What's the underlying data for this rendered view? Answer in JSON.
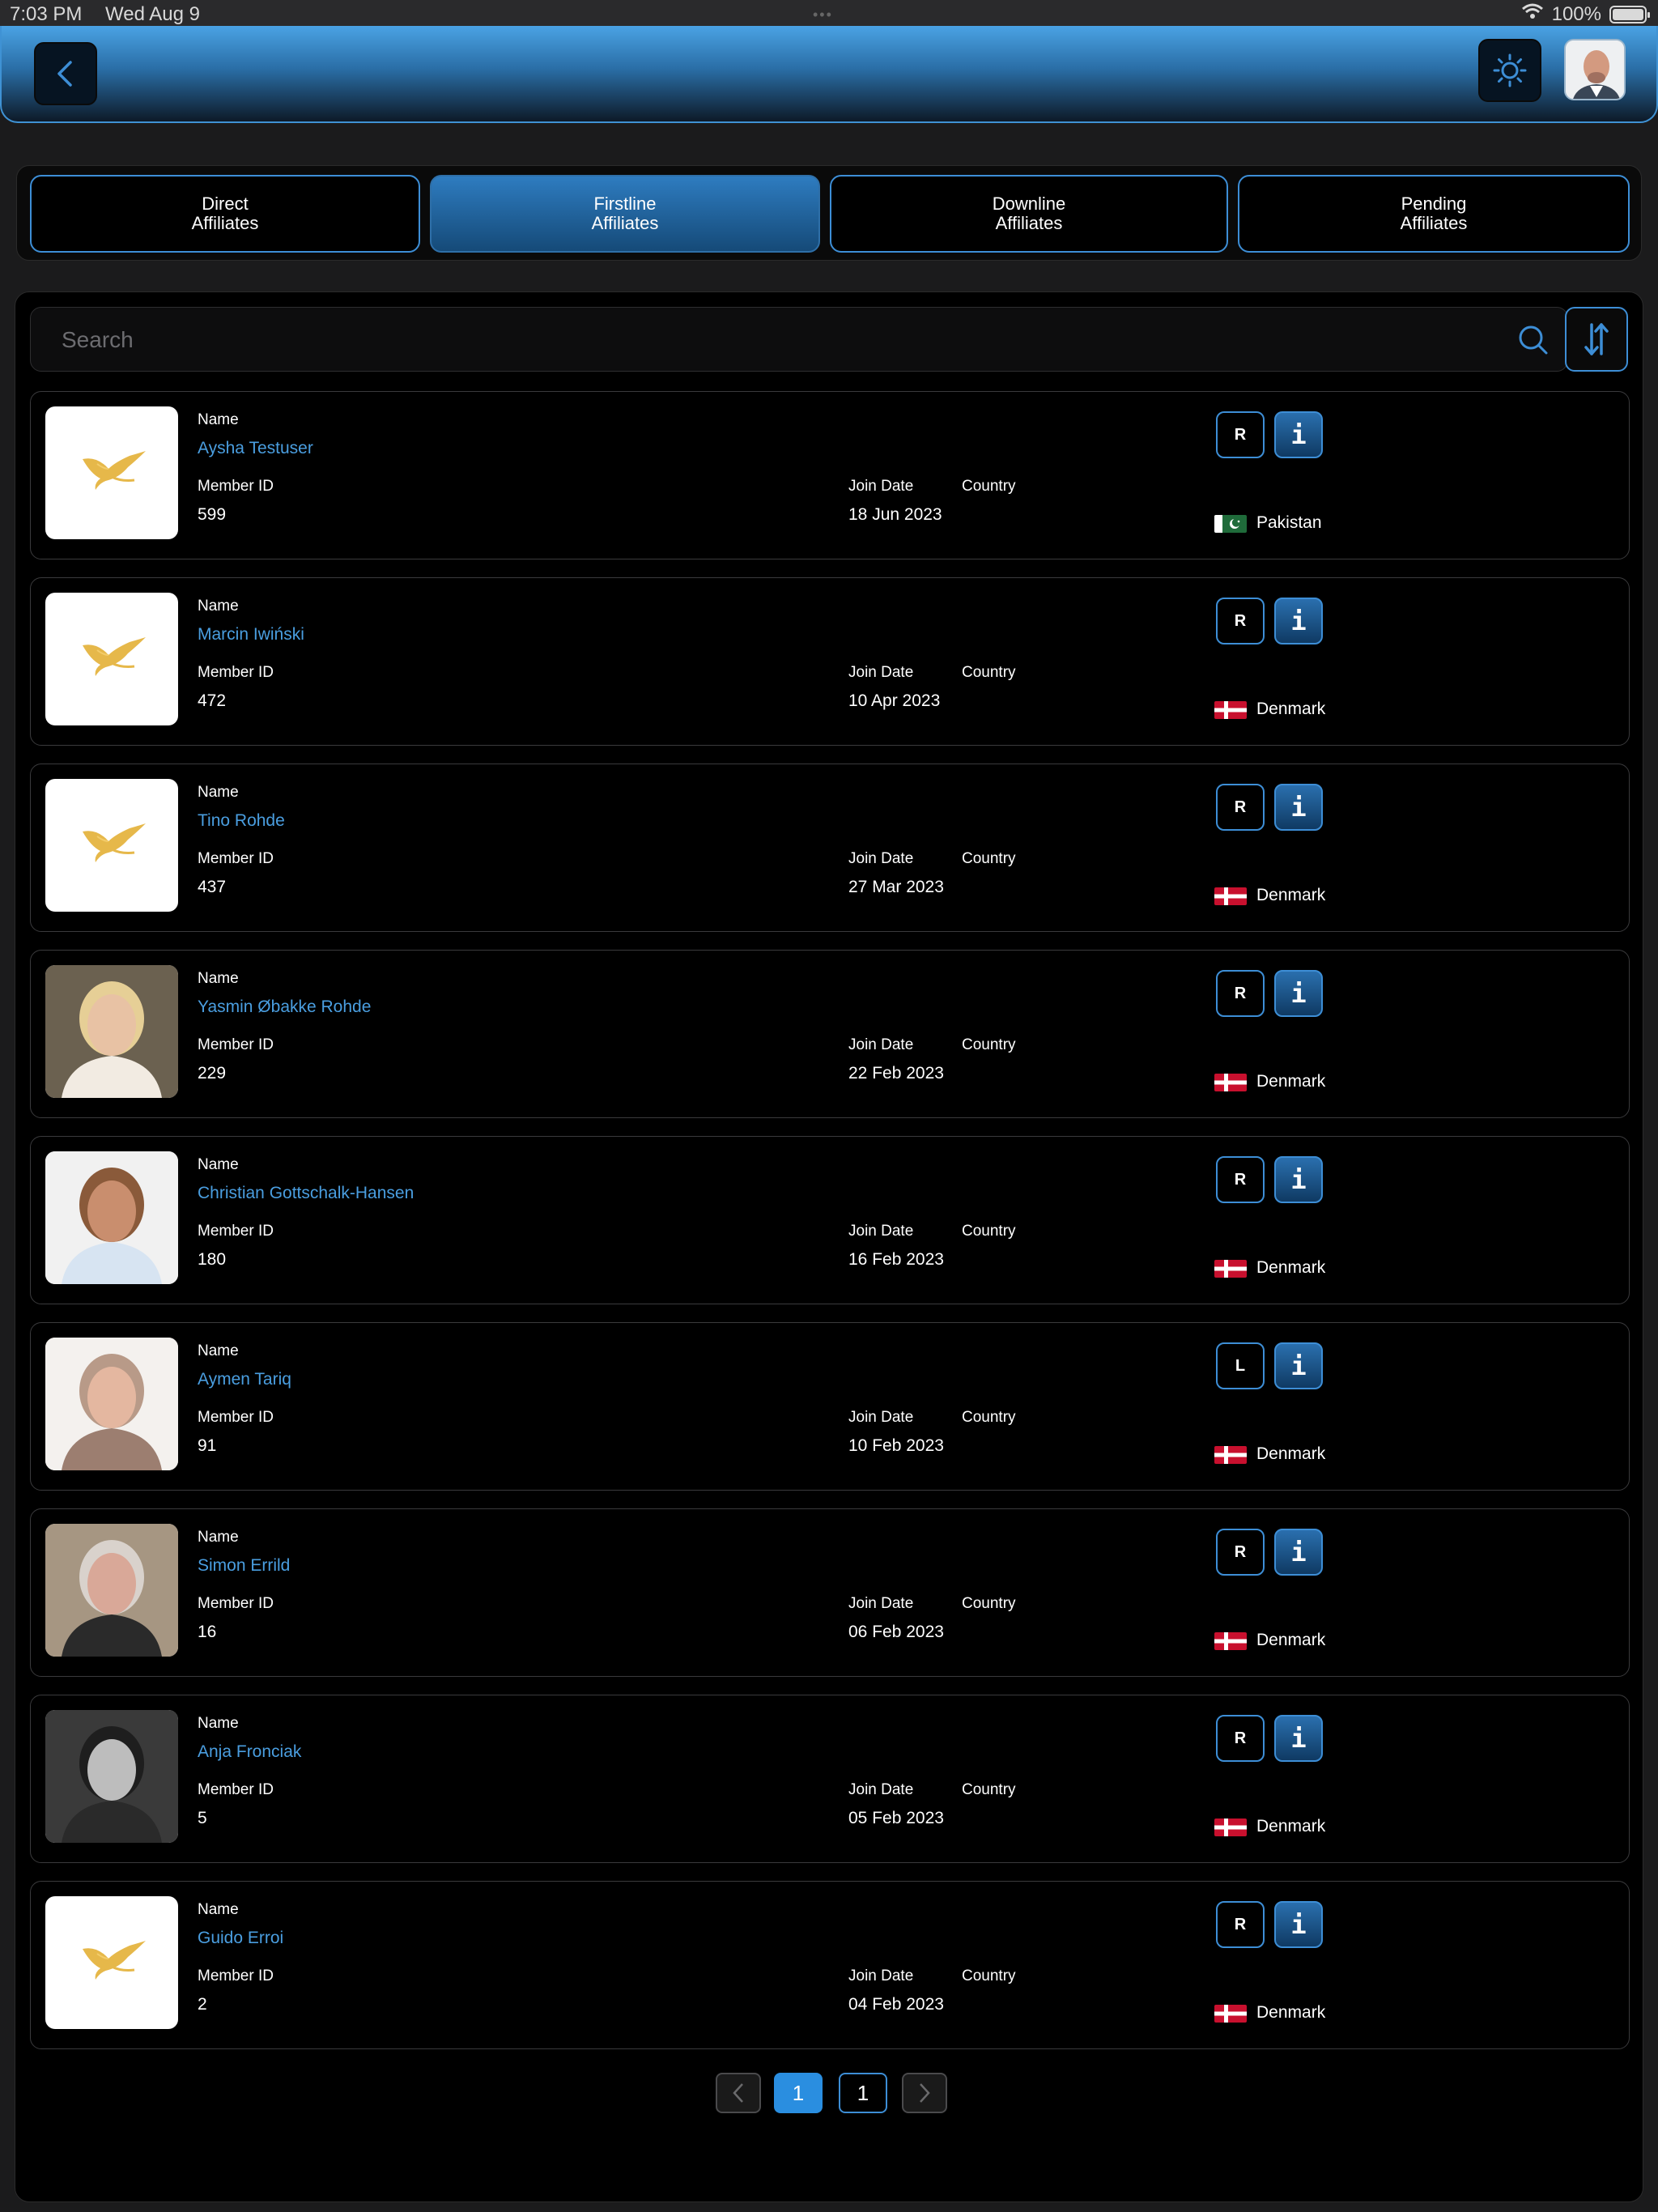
{
  "status_bar": {
    "time": "7:03 PM",
    "date": "Wed Aug 9",
    "battery": "100%"
  },
  "header": {
    "back_icon": "chevron-left-icon",
    "theme_icon": "sun-icon",
    "accent": "#3d8ed6"
  },
  "tabs": [
    {
      "line1": "Direct",
      "line2": "Affiliates",
      "active": false
    },
    {
      "line1": "Firstline",
      "line2": "Affiliates",
      "active": true
    },
    {
      "line1": "Downline",
      "line2": "Affiliates",
      "active": false
    },
    {
      "line1": "Pending",
      "line2": "Affiliates",
      "active": false
    }
  ],
  "search": {
    "placeholder": "Search",
    "value": ""
  },
  "labels": {
    "name": "Name",
    "member_id": "Member ID",
    "join_date": "Join Date",
    "country": "Country"
  },
  "affiliates": [
    {
      "name": "Aysha Testuser",
      "member_id": "599",
      "join_date": "18 Jun 2023",
      "country": "Pakistan",
      "badge": "R",
      "avatar": "logo"
    },
    {
      "name": "Marcin Iwiński",
      "member_id": "472",
      "join_date": "10 Apr 2023",
      "country": "Denmark",
      "badge": "R",
      "avatar": "logo"
    },
    {
      "name": "Tino Rohde",
      "member_id": "437",
      "join_date": "27 Mar 2023",
      "country": "Denmark",
      "badge": "R",
      "avatar": "logo"
    },
    {
      "name": "Yasmin Øbakke Rohde",
      "member_id": "229",
      "join_date": "22 Feb 2023",
      "country": "Denmark",
      "badge": "R",
      "avatar": "photo"
    },
    {
      "name": "Christian Gottschalk-Hansen",
      "member_id": "180",
      "join_date": "16 Feb 2023",
      "country": "Denmark",
      "badge": "R",
      "avatar": "photo"
    },
    {
      "name": "Aymen Tariq",
      "member_id": "91",
      "join_date": "10 Feb 2023",
      "country": "Denmark",
      "badge": "L",
      "avatar": "photo"
    },
    {
      "name": "Simon Errild",
      "member_id": "16",
      "join_date": "06 Feb 2023",
      "country": "Denmark",
      "badge": "R",
      "avatar": "photo"
    },
    {
      "name": "Anja Fronciak",
      "member_id": "5",
      "join_date": "05 Feb 2023",
      "country": "Denmark",
      "badge": "R",
      "avatar": "photo"
    },
    {
      "name": "Guido Erroi",
      "member_id": "2",
      "join_date": "04 Feb 2023",
      "country": "Denmark",
      "badge": "R",
      "avatar": "logo"
    }
  ],
  "pagination": {
    "current": "1",
    "total": "1"
  }
}
